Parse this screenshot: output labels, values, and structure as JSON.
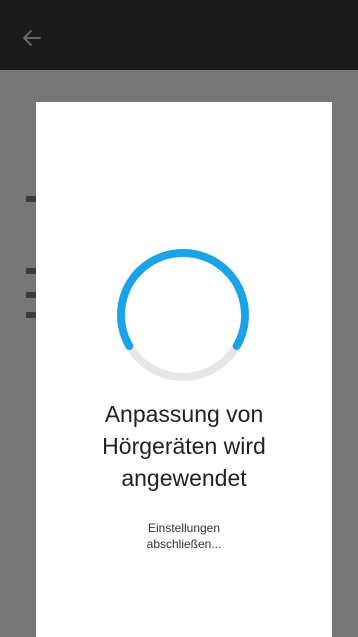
{
  "app_bar": {
    "back_icon": "arrow-left-icon"
  },
  "dialog": {
    "title_line1": "Anpassung von",
    "title_line2": "Hörgeräten wird",
    "title_line3": "angewendet",
    "subtitle_line1": "Einstellungen",
    "subtitle_line2": "abschließen..."
  },
  "colors": {
    "spinner_active": "#1aa3e8",
    "spinner_track": "#e6e6e6",
    "app_bar": "#1b1b1b",
    "scrim": "#777777"
  }
}
